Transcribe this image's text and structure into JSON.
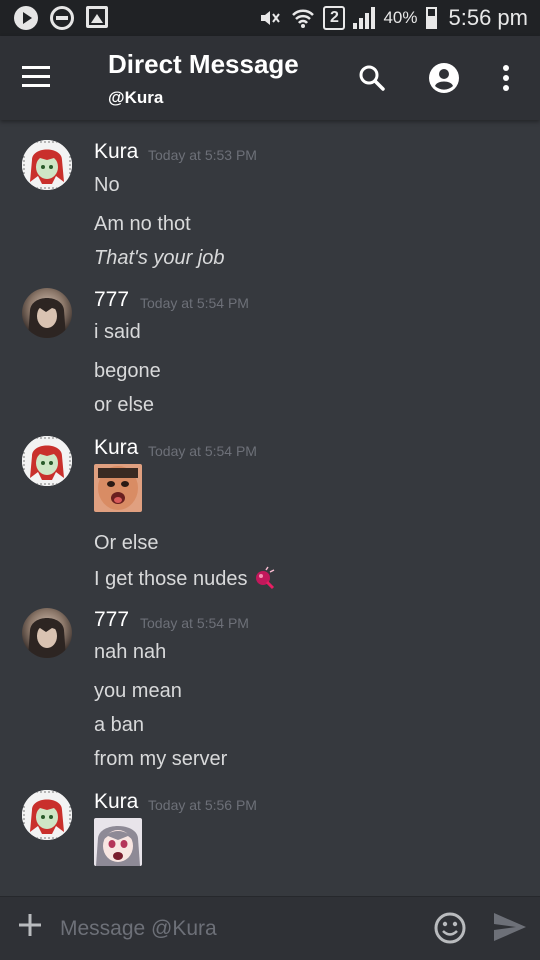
{
  "status_bar": {
    "sim_slot": "2",
    "battery": "40%",
    "time": "5:56 pm"
  },
  "header": {
    "title": "Direct Message",
    "subtitle": "@Kura",
    "icons": [
      "menu-icon",
      "search-icon",
      "account-icon",
      "more-vert-icon"
    ]
  },
  "groups": [
    {
      "author": "Kura",
      "timestamp": "Today at 5:53 PM",
      "messages": [
        "No",
        "Am no thot",
        "That's your job"
      ]
    },
    {
      "author": "777",
      "timestamp": "Today at 5:54 PM",
      "messages": [
        "i said",
        "begone",
        "or else"
      ]
    },
    {
      "author": "Kura",
      "timestamp": "Today at 5:54 PM",
      "messages": [
        "Or else",
        "I get those nudes"
      ]
    },
    {
      "author": "777",
      "timestamp": "Today at 5:54 PM",
      "messages": [
        "nah nah",
        "you mean",
        "a ban",
        "from my server"
      ]
    },
    {
      "author": "Kura",
      "timestamp": "Today at 5:56 PM",
      "messages": []
    }
  ],
  "composer": {
    "placeholder": "Message @Kura"
  },
  "colors": {
    "background": "#36393e",
    "header": "#2f3136",
    "status_bar": "#202225",
    "timestamp": "#6d7078",
    "text": "#d8d9da"
  }
}
